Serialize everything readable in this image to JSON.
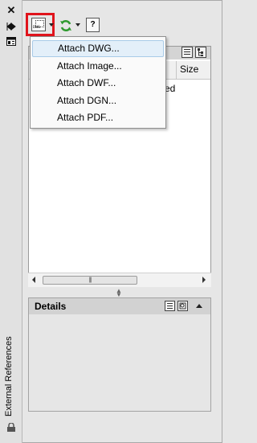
{
  "palette": {
    "title": "External References"
  },
  "toolbar": {
    "attach_icon": "attach-dwg-icon",
    "refresh_icon": "refresh-icon",
    "help_icon": "help-icon",
    "help_glyph": "?"
  },
  "attach_menu": {
    "items": [
      {
        "label": "Attach DWG..."
      },
      {
        "label": "Attach Image..."
      },
      {
        "label": "Attach DWF..."
      },
      {
        "label": "Attach DGN..."
      },
      {
        "label": "Attach PDF..."
      }
    ]
  },
  "file_references": {
    "columns": [
      "Size"
    ],
    "partial_row_text": "ed",
    "scroll_grip": "|||"
  },
  "details": {
    "title": "Details"
  },
  "colors": {
    "highlight": "#e0141c",
    "menu_hover": "#e3eff9"
  }
}
